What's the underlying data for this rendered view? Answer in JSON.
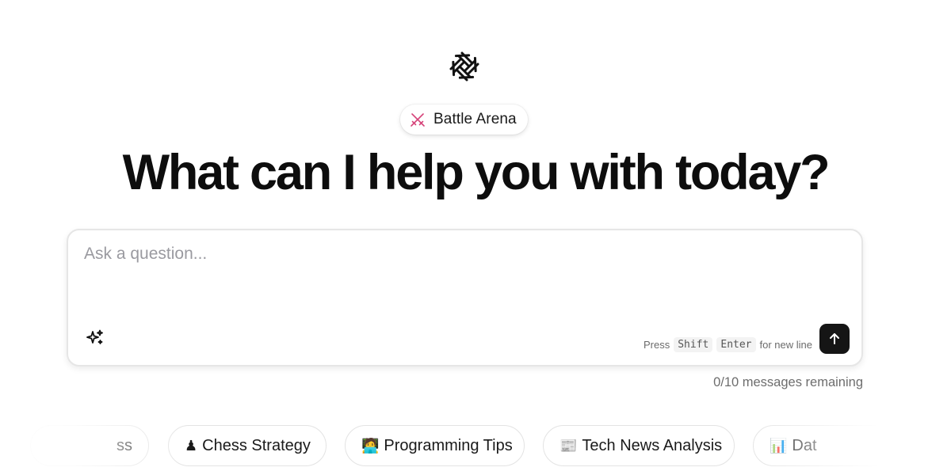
{
  "header": {
    "logo_icon": "radial-burst-logo-icon",
    "arena_icon": "crossed-swords-icon",
    "arena_label": "Battle Arena",
    "accent_color": "#d6457a"
  },
  "headline": "What can I help you with today?",
  "composer": {
    "placeholder": "Ask a question...",
    "value": "",
    "enhance_icon": "sparkle-icon",
    "hint_prefix": "Press",
    "hint_key_1": "Shift",
    "hint_key_2": "Enter",
    "hint_suffix": "for new line",
    "send_icon": "arrow-up-icon"
  },
  "status": {
    "remaining": "0/10 messages remaining"
  },
  "suggestions": [
    {
      "emoji": "",
      "label": "ss"
    },
    {
      "emoji": "♟",
      "label": "Chess Strategy"
    },
    {
      "emoji": "🧑‍💻",
      "label": "Programming Tips"
    },
    {
      "emoji": "📰",
      "label": "Tech News Analysis"
    },
    {
      "emoji": "📊",
      "label": "Dat"
    }
  ]
}
